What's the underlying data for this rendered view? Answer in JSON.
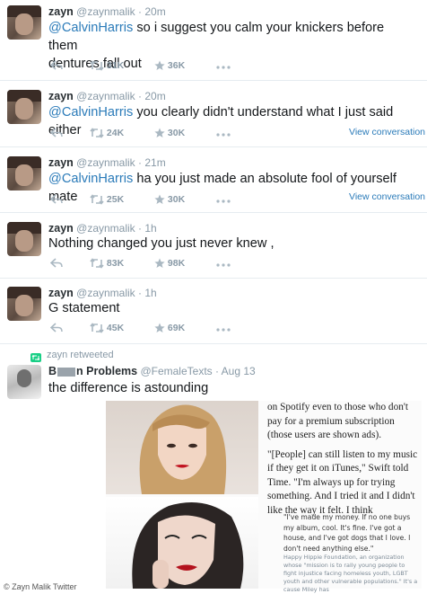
{
  "tweets": [
    {
      "name": "zayn",
      "handle": "@zaynmalik",
      "time": "· 20m",
      "mention": "@CalvinHarris",
      "text_line1": " so i suggest you calm your knickers before them",
      "text_line2": "dentures fall out",
      "retweets": "31K",
      "favorites": "36K",
      "view_conversation": ""
    },
    {
      "name": "zayn",
      "handle": "@zaynmalik",
      "time": "· 20m",
      "mention": "@CalvinHarris",
      "text_line1": " you clearly didn't understand what I just said either",
      "text_line2": "",
      "retweets": "24K",
      "favorites": "30K",
      "view_conversation": "View conversation"
    },
    {
      "name": "zayn",
      "handle": "@zaynmalik",
      "time": "· 21m",
      "mention": "@CalvinHarris",
      "text_line1": " ha you just made an absolute fool of yourself mate",
      "text_line2": "",
      "retweets": "25K",
      "favorites": "30K",
      "view_conversation": "View conversation"
    },
    {
      "name": "zayn",
      "handle": "@zaynmalik",
      "time": "· 1h",
      "mention": "",
      "text_line1": "Nothing changed you just never knew ,",
      "text_line2": "",
      "retweets": "83K",
      "favorites": "98K",
      "view_conversation": ""
    },
    {
      "name": "zayn",
      "handle": "@zaynmalik",
      "time": "· 1h",
      "mention": "",
      "text_line1": "G statement",
      "text_line2": "",
      "retweets": "45K",
      "favorites": "69K",
      "view_conversation": ""
    }
  ],
  "retweet": {
    "label": "zayn retweeted",
    "name_prefix": "B",
    "name_suffix": "n Problems",
    "handle": "@FemaleTexts",
    "time": "· Aug 13",
    "text": "the difference is astounding"
  },
  "article": {
    "para1": "on Spotify even to those who don't pay for a premium subscription (those users are shown ads).",
    "para2": "\"[People] can still listen to my music if they get it on iTunes,\" Swift told Time. \"I'm always up for trying something. And I tried it and I didn't like the way it felt. I think",
    "quote": "\"I've made my money. If no one buys my album, cool. It's fine. I've got a house, and I've got dogs that I love. I don't need anything else.\"",
    "footnote": "Happy Hippie Foundation, an organization whose \"mission is to rally young people to fight injustice facing homeless youth, LGBT youth and other vulnerable populations.\" It's a cause Miley has"
  },
  "watermark": "© Zayn Malik Twitter",
  "icons": [
    "reply-icon",
    "retweet-icon",
    "favorite-icon",
    "more-icon"
  ],
  "colors": {
    "link": "#2b7bb9",
    "muted": "#8899a6",
    "text": "#14171a",
    "retweet_green": "#19cf86"
  }
}
